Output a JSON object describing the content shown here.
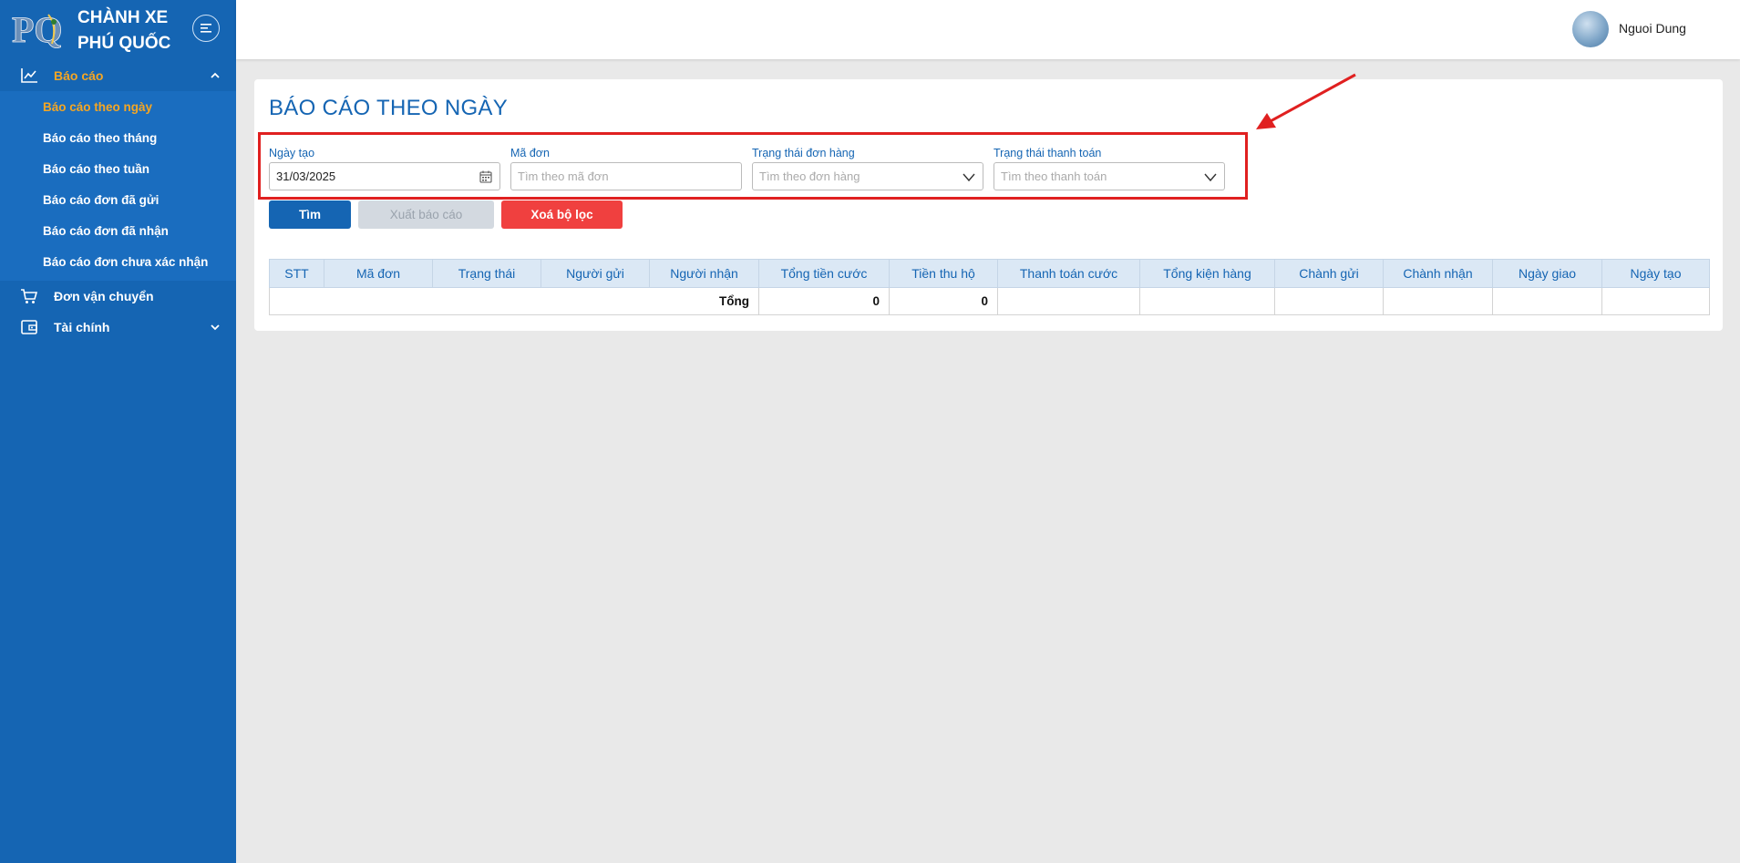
{
  "app": {
    "brand_line1": "CHÀNH XE",
    "brand_line2": "PHÚ QUỐC",
    "logo_text": "PQ"
  },
  "sidebar": {
    "sections": [
      {
        "label": "Báo cáo",
        "icon": "line-chart-icon",
        "expanded": true,
        "items": [
          {
            "label": "Báo cáo theo ngày",
            "active": true
          },
          {
            "label": "Báo cáo theo tháng"
          },
          {
            "label": "Báo cáo theo tuần"
          },
          {
            "label": "Báo cáo đơn đã gửi"
          },
          {
            "label": "Báo cáo đơn đã nhận"
          },
          {
            "label": "Báo cáo đơn chưa xác nhận"
          }
        ]
      },
      {
        "label": "Đơn vận chuyển",
        "icon": "cart-icon"
      },
      {
        "label": "Tài chính",
        "icon": "wallet-icon",
        "expanded": false
      }
    ]
  },
  "header": {
    "user_name": "Nguoi Dung"
  },
  "page": {
    "title": "BÁO CÁO THEO NGÀY",
    "filters": {
      "created_date": {
        "label": "Ngày tạo",
        "value": "31/03/2025"
      },
      "order_code": {
        "label": "Mã đơn",
        "placeholder": "Tìm theo mã đơn"
      },
      "order_status": {
        "label": "Trạng thái đơn hàng",
        "placeholder": "Tìm theo đơn hàng"
      },
      "payment_status": {
        "label": "Trạng thái thanh toán",
        "placeholder": "Tìm theo thanh toán"
      }
    },
    "buttons": {
      "search": "Tìm",
      "export": "Xuất báo cáo",
      "clear": "Xoá bộ lọc"
    },
    "table": {
      "columns": [
        "STT",
        "Mã đơn",
        "Trạng thái",
        "Người gửi",
        "Người nhận",
        "Tổng tiền cước",
        "Tiền thu hộ",
        "Thanh toán cước",
        "Tổng kiện hàng",
        "Chành gửi",
        "Chành nhận",
        "Ngày giao",
        "Ngày tạo"
      ],
      "total_row": {
        "label": "Tổng",
        "total_fee": "0",
        "cod": "0"
      }
    }
  },
  "colors": {
    "sidebar_bg": "#1565b3",
    "accent_active": "#f5a623",
    "title_blue": "#1565b3",
    "danger": "#f0403f",
    "highlight_border": "#e02020"
  }
}
